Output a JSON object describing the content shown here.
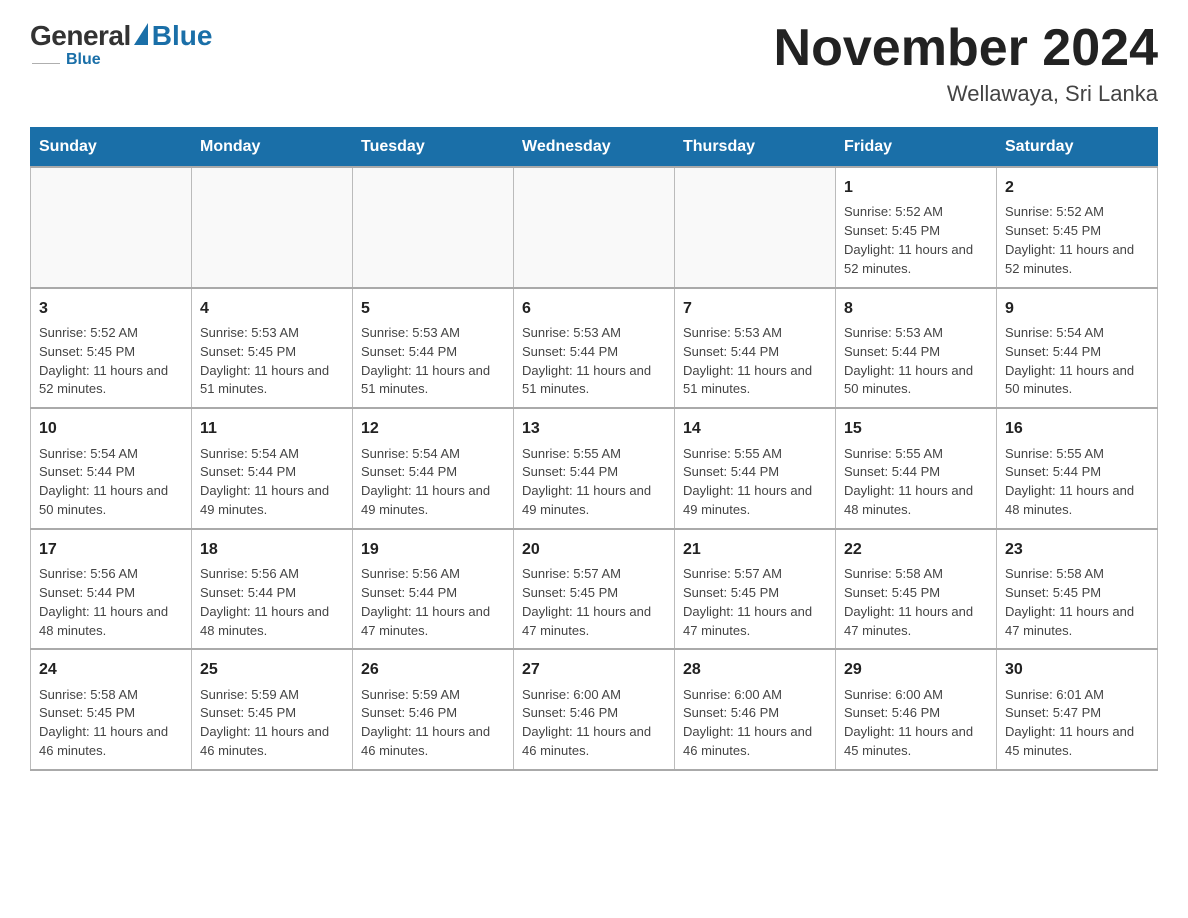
{
  "logo": {
    "general": "General",
    "blue": "Blue",
    "triangle_color": "#1a6fa8"
  },
  "header": {
    "month_title": "November 2024",
    "location": "Wellawaya, Sri Lanka"
  },
  "days_of_week": [
    "Sunday",
    "Monday",
    "Tuesday",
    "Wednesday",
    "Thursday",
    "Friday",
    "Saturday"
  ],
  "weeks": [
    [
      {
        "day": "",
        "info": ""
      },
      {
        "day": "",
        "info": ""
      },
      {
        "day": "",
        "info": ""
      },
      {
        "day": "",
        "info": ""
      },
      {
        "day": "",
        "info": ""
      },
      {
        "day": "1",
        "info": "Sunrise: 5:52 AM\nSunset: 5:45 PM\nDaylight: 11 hours and 52 minutes."
      },
      {
        "day": "2",
        "info": "Sunrise: 5:52 AM\nSunset: 5:45 PM\nDaylight: 11 hours and 52 minutes."
      }
    ],
    [
      {
        "day": "3",
        "info": "Sunrise: 5:52 AM\nSunset: 5:45 PM\nDaylight: 11 hours and 52 minutes."
      },
      {
        "day": "4",
        "info": "Sunrise: 5:53 AM\nSunset: 5:45 PM\nDaylight: 11 hours and 51 minutes."
      },
      {
        "day": "5",
        "info": "Sunrise: 5:53 AM\nSunset: 5:44 PM\nDaylight: 11 hours and 51 minutes."
      },
      {
        "day": "6",
        "info": "Sunrise: 5:53 AM\nSunset: 5:44 PM\nDaylight: 11 hours and 51 minutes."
      },
      {
        "day": "7",
        "info": "Sunrise: 5:53 AM\nSunset: 5:44 PM\nDaylight: 11 hours and 51 minutes."
      },
      {
        "day": "8",
        "info": "Sunrise: 5:53 AM\nSunset: 5:44 PM\nDaylight: 11 hours and 50 minutes."
      },
      {
        "day": "9",
        "info": "Sunrise: 5:54 AM\nSunset: 5:44 PM\nDaylight: 11 hours and 50 minutes."
      }
    ],
    [
      {
        "day": "10",
        "info": "Sunrise: 5:54 AM\nSunset: 5:44 PM\nDaylight: 11 hours and 50 minutes."
      },
      {
        "day": "11",
        "info": "Sunrise: 5:54 AM\nSunset: 5:44 PM\nDaylight: 11 hours and 49 minutes."
      },
      {
        "day": "12",
        "info": "Sunrise: 5:54 AM\nSunset: 5:44 PM\nDaylight: 11 hours and 49 minutes."
      },
      {
        "day": "13",
        "info": "Sunrise: 5:55 AM\nSunset: 5:44 PM\nDaylight: 11 hours and 49 minutes."
      },
      {
        "day": "14",
        "info": "Sunrise: 5:55 AM\nSunset: 5:44 PM\nDaylight: 11 hours and 49 minutes."
      },
      {
        "day": "15",
        "info": "Sunrise: 5:55 AM\nSunset: 5:44 PM\nDaylight: 11 hours and 48 minutes."
      },
      {
        "day": "16",
        "info": "Sunrise: 5:55 AM\nSunset: 5:44 PM\nDaylight: 11 hours and 48 minutes."
      }
    ],
    [
      {
        "day": "17",
        "info": "Sunrise: 5:56 AM\nSunset: 5:44 PM\nDaylight: 11 hours and 48 minutes."
      },
      {
        "day": "18",
        "info": "Sunrise: 5:56 AM\nSunset: 5:44 PM\nDaylight: 11 hours and 48 minutes."
      },
      {
        "day": "19",
        "info": "Sunrise: 5:56 AM\nSunset: 5:44 PM\nDaylight: 11 hours and 47 minutes."
      },
      {
        "day": "20",
        "info": "Sunrise: 5:57 AM\nSunset: 5:45 PM\nDaylight: 11 hours and 47 minutes."
      },
      {
        "day": "21",
        "info": "Sunrise: 5:57 AM\nSunset: 5:45 PM\nDaylight: 11 hours and 47 minutes."
      },
      {
        "day": "22",
        "info": "Sunrise: 5:58 AM\nSunset: 5:45 PM\nDaylight: 11 hours and 47 minutes."
      },
      {
        "day": "23",
        "info": "Sunrise: 5:58 AM\nSunset: 5:45 PM\nDaylight: 11 hours and 47 minutes."
      }
    ],
    [
      {
        "day": "24",
        "info": "Sunrise: 5:58 AM\nSunset: 5:45 PM\nDaylight: 11 hours and 46 minutes."
      },
      {
        "day": "25",
        "info": "Sunrise: 5:59 AM\nSunset: 5:45 PM\nDaylight: 11 hours and 46 minutes."
      },
      {
        "day": "26",
        "info": "Sunrise: 5:59 AM\nSunset: 5:46 PM\nDaylight: 11 hours and 46 minutes."
      },
      {
        "day": "27",
        "info": "Sunrise: 6:00 AM\nSunset: 5:46 PM\nDaylight: 11 hours and 46 minutes."
      },
      {
        "day": "28",
        "info": "Sunrise: 6:00 AM\nSunset: 5:46 PM\nDaylight: 11 hours and 46 minutes."
      },
      {
        "day": "29",
        "info": "Sunrise: 6:00 AM\nSunset: 5:46 PM\nDaylight: 11 hours and 45 minutes."
      },
      {
        "day": "30",
        "info": "Sunrise: 6:01 AM\nSunset: 5:47 PM\nDaylight: 11 hours and 45 minutes."
      }
    ]
  ]
}
